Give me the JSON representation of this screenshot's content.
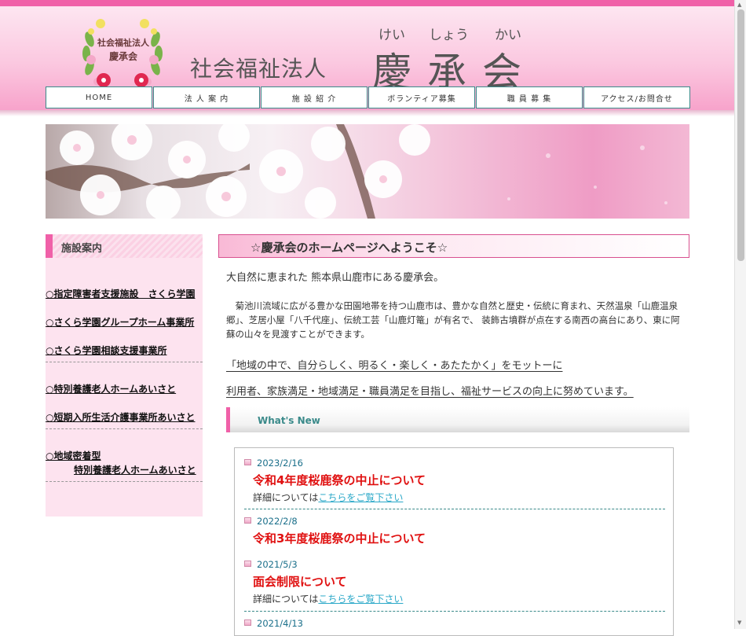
{
  "header": {
    "logo_line1": "社会福祉法人",
    "logo_line2": "慶承会",
    "org_type": "社会福祉法人",
    "org_name": "慶承会",
    "furigana": [
      "けい",
      "しょう",
      "かい"
    ]
  },
  "nav": [
    {
      "label": "HOME"
    },
    {
      "label": "法 人 案 内"
    },
    {
      "label": "施 設 紹 介"
    },
    {
      "label": "ボランティア募集"
    },
    {
      "label": "職 員 募 集"
    },
    {
      "label": "アクセス/お問合せ"
    }
  ],
  "sidebar": {
    "heading": "施設案内",
    "items": [
      {
        "label": "○指定障害者支援施設　さくら学園"
      },
      {
        "label": "○さくら学園グループホーム事業所"
      },
      {
        "label": "○さくら学園相談支援事業所"
      },
      {
        "label": "○特別養護老人ホームあいさと"
      },
      {
        "label": "○短期入所生活介護事業所あいさと"
      },
      {
        "label": "○地域密着型",
        "label2": "特別養護老人ホームあいさと"
      }
    ]
  },
  "main": {
    "welcome": "☆慶承会のホームページへようこそ☆",
    "intro": "大自然に恵まれた 熊本県山鹿市にある慶承会。",
    "description": "　菊池川流域に広がる豊かな田園地帯を持つ山鹿市は、豊かな自然と歴史・伝統に育まれ、天然温泉「山鹿温泉郷」、芝居小屋「八千代座」、伝統工芸「山鹿灯篭」が有名で、 装飾古墳群が点在する南西の高台にあり、東に阿蘇の山々を見渡すことができます。",
    "motto1": "「地域の中で、自分らしく、明るく・楽しく・あたたかく」をモットーに",
    "motto2": "利用者、家族満足・地域満足・職員満足を目指し、福祉サービスの向上に努めています。",
    "whats_new": "What's New"
  },
  "news": [
    {
      "date": "2023/2/16",
      "title": "令和4年度桜鹿祭の中止について",
      "detail_prefix": "詳細については",
      "link": "こちらをご覧下さい"
    },
    {
      "date": "2022/2/8",
      "title": "令和3年度桜鹿祭の中止について"
    },
    {
      "date": "2021/5/3",
      "title": "面会制限について",
      "detail_prefix": "詳細については",
      "link": "こちらをご覧下さい"
    },
    {
      "date": "2021/4/13"
    }
  ],
  "colors": {
    "accent_pink": "#f060a8",
    "news_title_red": "#e01010",
    "link_cyan": "#2aa8c8",
    "nav_border": "#3a8a8a"
  }
}
